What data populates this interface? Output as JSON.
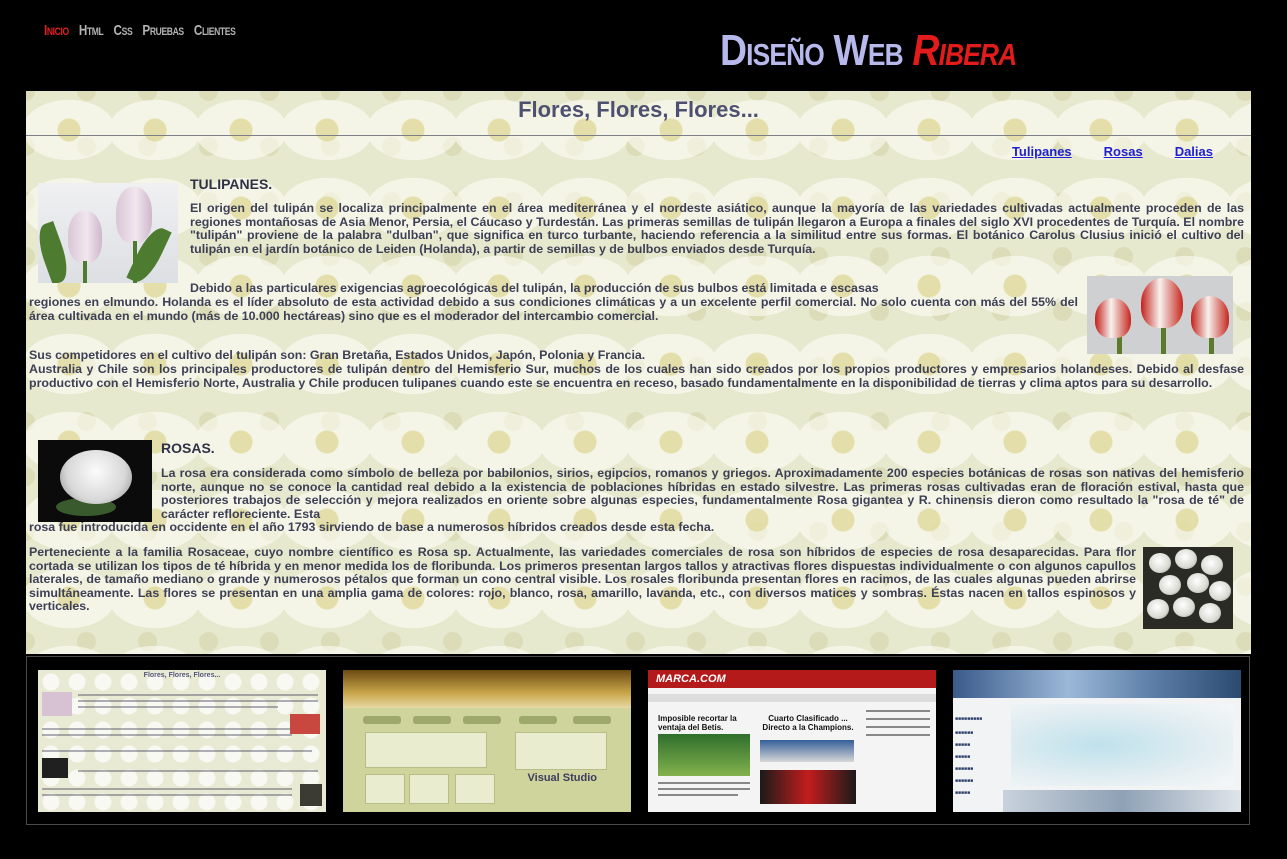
{
  "nav": {
    "items": [
      {
        "label": "Inicio",
        "active": true
      },
      {
        "label": "Html",
        "active": false
      },
      {
        "label": "Css",
        "active": false
      },
      {
        "label": "Pruebas",
        "active": false
      },
      {
        "label": "Clientes",
        "active": false
      }
    ]
  },
  "brand": {
    "part1": "Diseño Web",
    "part2": "Ribera"
  },
  "page": {
    "title": "Flores, Flores, Flores...",
    "anchors": [
      "Tulipanes",
      "Rosas",
      "Dalias"
    ],
    "tulipanes": {
      "heading": "TULIPANES.",
      "p1": "El origen del tulipán se localiza principalmente en el área mediterránea y el nordeste asiático, aunque la mayoría de las variedades cultivadas actualmente proceden de las regiones montañosas de Asia Menor, Persia, el Cáucaso y Turdestán. Las primeras semillas de tulipán llegaron a Europa a finales del siglo XVI procedentes de Turquía. El nombre \"tulipán\" proviene de la palabra \"dulban\", que significa en turco turbante, haciendo referencia a la similitud entre sus formas. El botánico Carolus Clusius inició el cultivo del tulipán en el jardín botánico de Leiden (Holanda), a partir de semillas y de bulbos enviados desde Turquía.",
      "p2_indent": "Debido a las particulares exigencias agroecológicas del tulipán, la producción de sus bulbos está limitada e escasas",
      "p2_rest": "regiones en elmundo. Holanda es el líder absoluto de esta actividad debido a sus condiciones climáticas y a un excelente perfil comercial. No solo cuenta con más del 55% del área cultivada en el mundo (más de 10.000 hectáreas) sino que es el moderador del intercambio comercial.",
      "p3": "Sus competidores en el cultivo del tulipán son: Gran Bretaña, Estados Unidos, Japón, Polonia y Francia.",
      "p4": "Australia y Chile son los principales productores de tulipán dentro del Hemisferio Sur, muchos de los cuales han sido creados por los propios productores y empresarios holandeses. Debido al desfase productivo con el Hemisferio Norte, Australia y Chile producen tulipanes cuando este se encuentra en receso, basado fundamentalmente en la disponibilidad de tierras y clima aptos para su desarrollo."
    },
    "rosas": {
      "heading": "ROSAS.",
      "p1": "La rosa era considerada como símbolo de belleza por babilonios, sirios, egipcios, romanos y griegos. Aproximadamente 200 especies botánicas de rosas son nativas del hemisferio norte, aunque no se conoce la cantidad real debido a la existencia de poblaciones híbridas en estado silvestre. Las primeras rosas cultivadas eran de floración estival, hasta que posteriores trabajos de selección y mejora realizados en oriente sobre algunas especies, fundamentalmente Rosa gigantea y R. chinensis dieron como resultado la \"rosa de té\" de carácter refloreciente. Esta",
      "p1_tail": "rosa fue introducida en occidente en el año 1793 sirviendo de base a numerosos híbridos creados desde esta fecha.",
      "p2": "Perteneciente a la familia Rosaceae, cuyo nombre científico es Rosa sp. Actualmente, las variedades comerciales de rosa son híbridos de especies de rosa desaparecidas. Para flor cortada se utilizan los tipos de té híbrida y en menor medida los de floribunda. Los primeros presentan largos tallos y atractivas flores dispuestas individualmente o con algunos capullos laterales, de tamaño mediano o grande y numerosos pétalos que forman un cono central visible. Los rosales floribunda presentan flores en racimos, de las cuales algunas pueden abrirse simultáneamente. Las flores se presentan en una amplia gama de colores: rojo, blanco, rosa, amarillo, lavanda, etc., con diversos matices y sombras. Éstas nacen en tallos espinosos y verticales."
    }
  },
  "thumbnails": {
    "t1_title": "Flores, Flores, Flores...",
    "t2_brand": "Visual Studio",
    "t3_logo": "MARCA.COM",
    "t3_head1": "Imposible recortar la ventaja del Betis.",
    "t3_head2": "Cuarto Clasificado ... Directo a la Champions."
  },
  "colors": {
    "background": "#000000",
    "nav_active": "#e02020",
    "nav_inactive": "#b3b3b3",
    "brand_blue": "#b7b9ec",
    "brand_red": "#e21b1b",
    "anchor_link": "#1f1fd1"
  }
}
